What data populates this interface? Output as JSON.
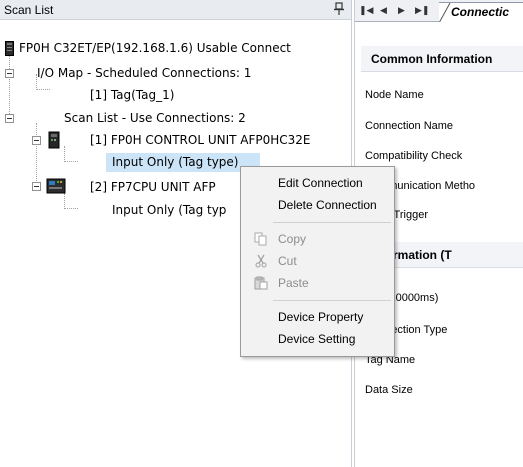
{
  "scan_list": {
    "title": "Scan List",
    "tree": {
      "root": "FP0H C32ET/EP(192.168.1.6)  Usable Connect",
      "io_map": "I/O Map - Scheduled Connections: 1",
      "io_map_item": "[1]  Tag(Tag_1)",
      "scan_list_header": "Scan List - Use Connections: 2",
      "unit1": "[1]  FP0H CONTROL UNIT AFP0HC32E",
      "unit1_child": "Input Only (Tag type)",
      "unit2": "[2]  FP7CPU UNIT AFP",
      "unit2_child": "Input Only (Tag typ"
    }
  },
  "properties": {
    "tab_label": "Connectic",
    "nav": [
      "⏮",
      "◀",
      "▶",
      "⏭"
    ],
    "common_header": "Common Information",
    "common_rows": [
      "Node Name",
      "Connection Name",
      "Compatibility Check",
      "Communication Metho",
      "Send Trigger"
    ],
    "info_header": "Information (T",
    "info_rows": [
      "1.0to10000ms)",
      "Connection Type",
      "Tag Name",
      "Data Size"
    ]
  },
  "context_menu": {
    "edit_connection": "Edit Connection",
    "delete_connection": "Delete Connection",
    "copy": "Copy",
    "cut": "Cut",
    "paste": "Paste",
    "device_property": "Device Property",
    "device_setting": "Device Setting"
  }
}
